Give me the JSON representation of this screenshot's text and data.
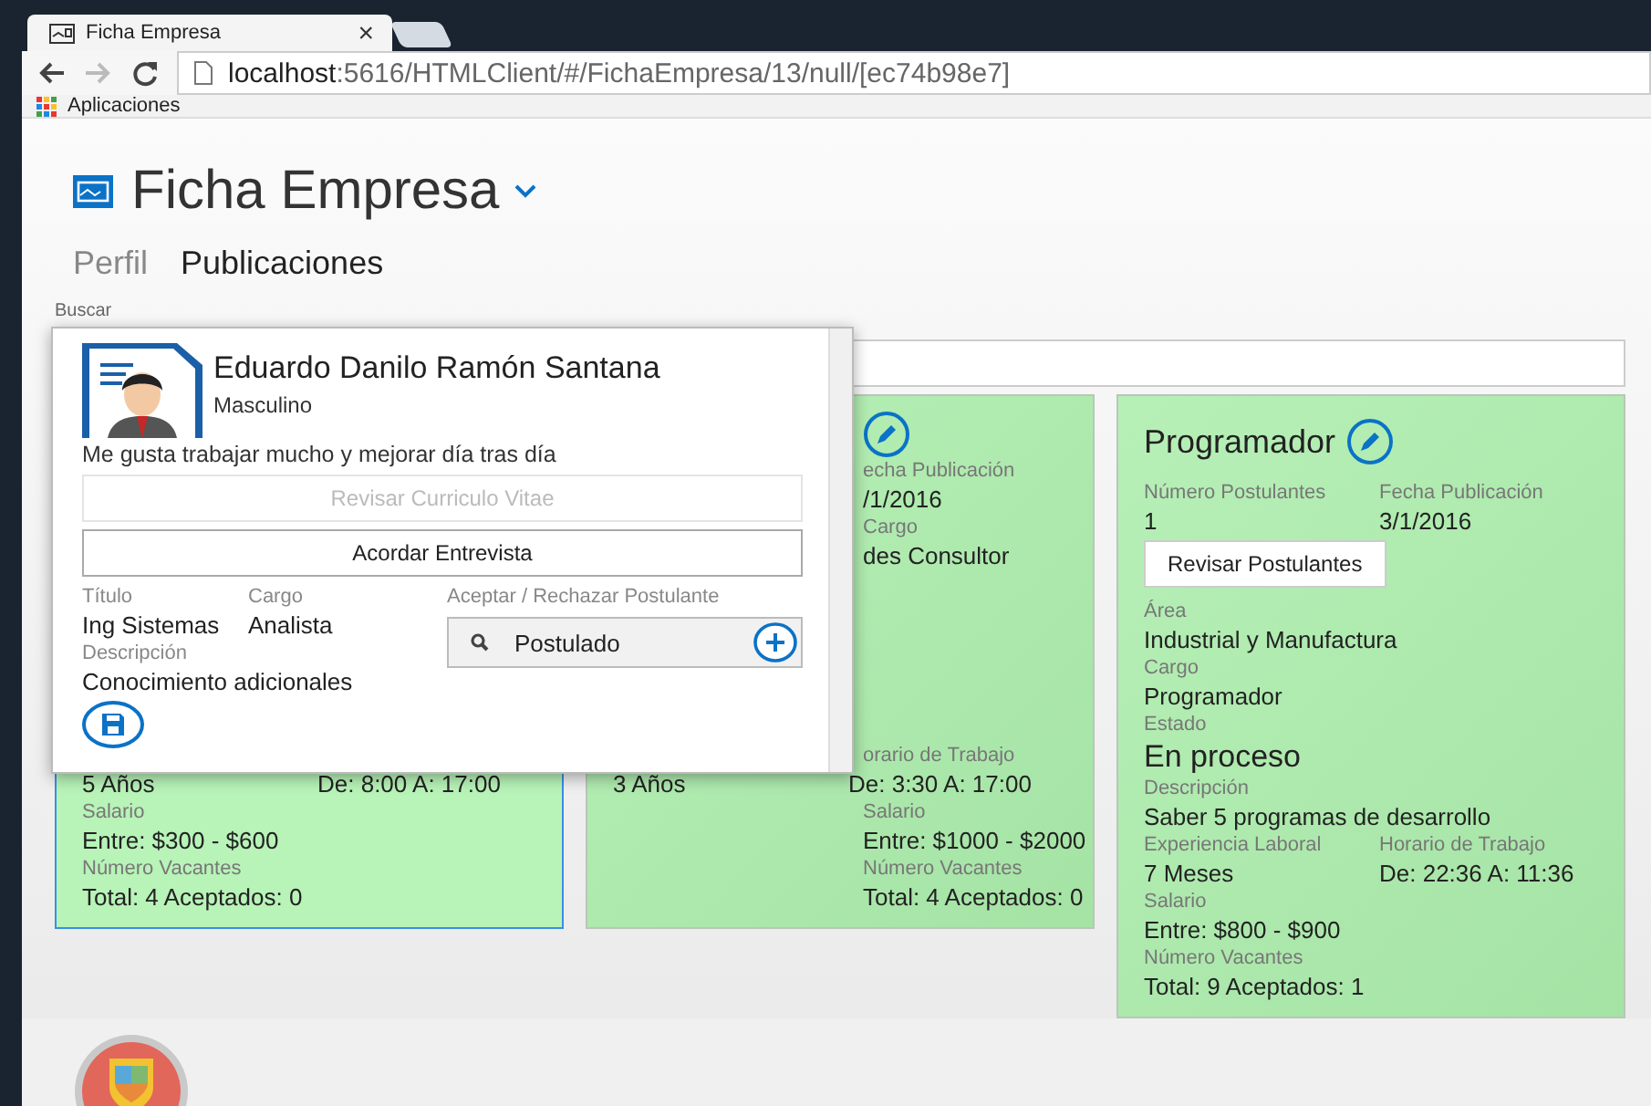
{
  "browser": {
    "tab_title": "Ficha Empresa",
    "tab_close": "×",
    "url_host": "localhost",
    "url_path": ":5616/HTMLClient/#/FichaEmpresa/13/null/[ec74b98e7]",
    "bookmark": "Aplicaciones"
  },
  "page": {
    "title": "Ficha Empresa"
  },
  "tabs": [
    {
      "label": "Perfil",
      "selected": false
    },
    {
      "label": "Publicaciones",
      "selected": true
    }
  ],
  "search": {
    "label": "Buscar"
  },
  "cards": [
    {
      "selected": true,
      "bottom": [
        {
          "cells": [
            {
              "kind": "value",
              "text": "5 Años"
            },
            {
              "kind": "value",
              "text": "De: 8:00 A: 17:00"
            }
          ]
        },
        {
          "cells": [
            {
              "kind": "label",
              "text": "Salario"
            }
          ]
        },
        {
          "cells": [
            {
              "kind": "value",
              "text": "Entre: $300 - $600"
            }
          ]
        },
        {
          "cells": [
            {
              "kind": "label",
              "text": "Número Vacantes"
            }
          ]
        },
        {
          "cells": [
            {
              "kind": "value",
              "text": "Total: 4 Aceptados: 0"
            }
          ]
        }
      ]
    },
    {
      "selected": false,
      "top": [
        {
          "cells": [
            {
              "kind": "edit"
            }
          ]
        },
        {
          "cells": [
            {
              "kind": "label",
              "text": "echa Publicación"
            }
          ]
        },
        {
          "cells": [
            {
              "kind": "value",
              "text": "/1/2016"
            }
          ]
        },
        {
          "cells": [
            {
              "kind": "label",
              "text": "Cargo"
            }
          ]
        },
        {
          "cells": [
            {
              "kind": "value",
              "text": "des Consultor"
            }
          ]
        }
      ],
      "bottom": [
        {
          "cells": [
            {
              "kind": "label",
              "text": "orario de Trabajo"
            }
          ]
        },
        {
          "cells": [
            {
              "kind": "value",
              "text": "3 Años"
            },
            {
              "kind": "value",
              "text": "De: 3:30 A: 17:00"
            }
          ]
        },
        {
          "cells": [
            {
              "kind": "label",
              "text": "Salario"
            }
          ]
        },
        {
          "cells": [
            {
              "kind": "value",
              "text": "Entre: $1000 - $2000"
            }
          ]
        },
        {
          "cells": [
            {
              "kind": "label",
              "text": "Número Vacantes"
            }
          ]
        },
        {
          "cells": [
            {
              "kind": "value",
              "text": "Total: 4 Aceptados: 0"
            }
          ]
        }
      ]
    },
    {
      "selected": false,
      "top": [
        {
          "cells": [
            {
              "kind": "title",
              "text": "Programador"
            }
          ]
        },
        {
          "cells": [
            {
              "kind": "label",
              "text": "Número Postulantes"
            },
            {
              "kind": "label",
              "text": "Fecha Publicación"
            }
          ]
        },
        {
          "cells": [
            {
              "kind": "value",
              "text": "1"
            },
            {
              "kind": "value",
              "text": "3/1/2016"
            }
          ]
        },
        {
          "cells": [
            {
              "kind": "button",
              "text": "Revisar Postulantes"
            }
          ]
        },
        {
          "cells": [
            {
              "kind": "label",
              "text": "Área"
            }
          ]
        },
        {
          "cells": [
            {
              "kind": "value",
              "text": "Industrial y Manufactura"
            }
          ]
        },
        {
          "cells": [
            {
              "kind": "label",
              "text": "Cargo"
            }
          ]
        },
        {
          "cells": [
            {
              "kind": "value",
              "text": "Programador"
            }
          ]
        },
        {
          "cells": [
            {
              "kind": "label",
              "text": "Estado"
            }
          ]
        },
        {
          "cells": [
            {
              "kind": "big",
              "text": "En proceso"
            }
          ]
        },
        {
          "cells": [
            {
              "kind": "label",
              "text": "Descripción"
            }
          ]
        },
        {
          "cells": [
            {
              "kind": "value",
              "text": "Saber 5 programas de desarrollo"
            }
          ]
        },
        {
          "cells": [
            {
              "kind": "label",
              "text": "Experiencia Laboral"
            },
            {
              "kind": "label",
              "text": "Horario de Trabajo"
            }
          ]
        },
        {
          "cells": [
            {
              "kind": "value",
              "text": "7 Meses"
            },
            {
              "kind": "value",
              "text": "De: 22:36 A: 11:36"
            }
          ]
        },
        {
          "cells": [
            {
              "kind": "label",
              "text": "Salario"
            }
          ]
        },
        {
          "cells": [
            {
              "kind": "value",
              "text": "Entre: $800 - $900"
            }
          ]
        },
        {
          "cells": [
            {
              "kind": "label",
              "text": "Número Vacantes"
            }
          ]
        },
        {
          "cells": [
            {
              "kind": "value",
              "text": "Total: 9 Aceptados: 1"
            }
          ]
        }
      ]
    }
  ],
  "popup": {
    "name": "Eduardo Danilo Ramón Santana",
    "gender": "Masculino",
    "about": "Me gusta trabajar mucho y mejorar día tras día",
    "buttons": [
      {
        "label": "Revisar Curriculo Vitae",
        "disabled": true
      },
      {
        "label": "Acordar Entrevista",
        "disabled": false
      }
    ],
    "titulo_label": "Título",
    "titulo": "Ing Sistemas",
    "cargo_label": "Cargo",
    "cargo": "Analista",
    "descripcion_label": "Descripción",
    "descripcion": "Conocimiento adicionales",
    "status_label": "Aceptar / Rechazar Postulante",
    "status": "Postulado"
  }
}
